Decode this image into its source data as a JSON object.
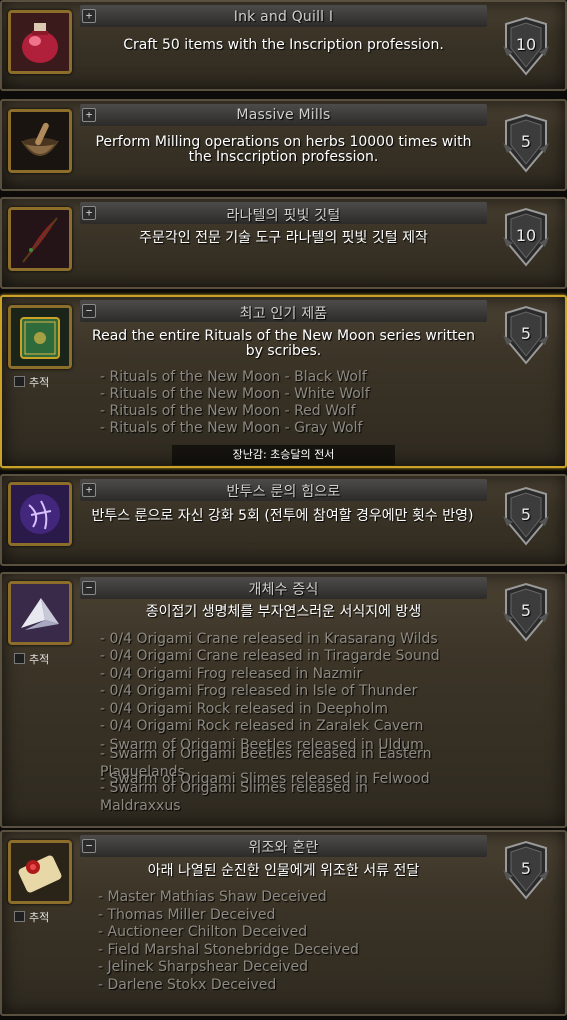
{
  "achievements": [
    {
      "title": "Ink and Quill I",
      "toggle": "+",
      "description": "Craft 50 items with the Inscription profession.",
      "points": "10",
      "icon": "potion-icon",
      "tracking_label": "",
      "criteria": [],
      "reward": ""
    },
    {
      "title": "Massive Mills",
      "toggle": "+",
      "description": "Perform Milling operations on herbs 10000 times with the Insccription profession.",
      "points": "5",
      "icon": "mortar-pestle-icon",
      "tracking_label": "",
      "criteria": [],
      "reward": ""
    },
    {
      "title": "라나텔의 핏빛 깃털",
      "toggle": "+",
      "description": "주문각인 전문 기술 도구 라나텔의 핏빛 깃털 제작",
      "points": "10",
      "icon": "red-quill-icon",
      "tracking_label": "",
      "criteria": [],
      "reward": ""
    },
    {
      "title": "최고 인기 제품",
      "toggle": "−",
      "description": "Read the entire Rituals of the New Moon series written by scribes.",
      "points": "5",
      "icon": "green-book-icon",
      "tracking_label": "추적",
      "criteria": [
        "- Rituals of the New Moon - Black Wolf",
        "- Rituals of the New Moon - White Wolf",
        "- Rituals of the New Moon - Red Wolf",
        "- Rituals of the New Moon - Gray Wolf"
      ],
      "reward": "장난감: 초승달의 전서"
    },
    {
      "title": "반투스 룬의 힘으로",
      "toggle": "+",
      "description": "반투스 룬으로 자신 강화 5회 (전투에 참여할 경우에만 횟수 반영)",
      "points": "5",
      "icon": "purple-rune-icon",
      "tracking_label": "",
      "criteria": [],
      "reward": ""
    },
    {
      "title": "개체수 증식",
      "toggle": "−",
      "description": "종이접기 생명체를 부자연스러운 서식지에 방생",
      "points": "5",
      "icon": "origami-crane-icon",
      "tracking_label": "추적",
      "criteria": [
        "- 0/4 Origami Crane released in Krasarang Wilds",
        "- 0/4 Origami Crane released in Tiragarde Sound",
        "- 0/4 Origami Frog released in Nazmir",
        "- 0/4 Origami Frog released in Isle of Thunder",
        "- 0/4 Origami Rock released in Deepholm",
        "- 0/4 Origami Rock released in Zaralek Cavern",
        "- Swarm of Origami Beetles released in Uldum",
        "- Swarm of Origami Beetles released in Eastern Plaguelands",
        "- Swarm of Origami Slimes released in Felwood",
        "- Swarm of Origami Slimes released in Maldraxxus"
      ],
      "reward": ""
    },
    {
      "title": "위조와 혼란",
      "toggle": "−",
      "description": "아래 나열된 순진한 인물에게 위조한 서류 전달",
      "points": "5",
      "icon": "scroll-seal-icon",
      "tracking_label": "추적",
      "criteria": [
        "- Master Mathias Shaw Deceived",
        "- Thomas Miller Deceived",
        "- Auctioneer Chilton Deceived",
        "- Field Marshal Stonebridge Deceived",
        "- Jelinek Sharpshear Deceived",
        "- Darlene Stokx Deceived"
      ],
      "reward": ""
    }
  ]
}
